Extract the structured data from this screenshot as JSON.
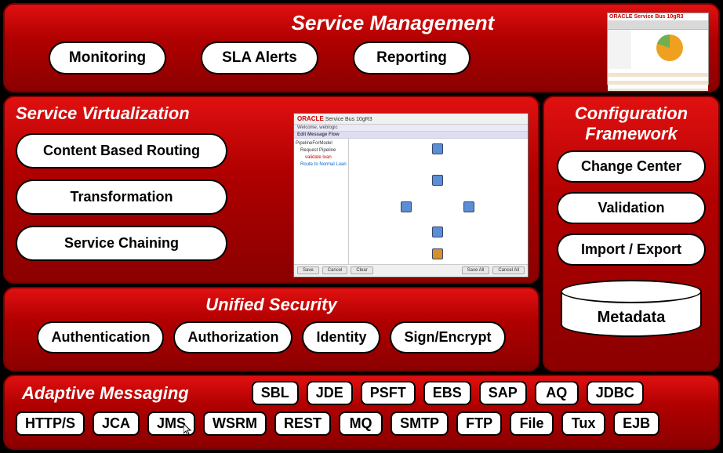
{
  "service_management": {
    "title": "Service Management",
    "items": [
      "Monitoring",
      "SLA Alerts",
      "Reporting"
    ],
    "thumb_label": "ORACLE Service Bus 10gR3"
  },
  "service_virtualization": {
    "title": "Service Virtualization",
    "items": [
      "Content Based Routing",
      "Transformation",
      "Service Chaining"
    ],
    "app": {
      "brand": "ORACLE",
      "product": "Service Bus 10gR3",
      "welcome": "Welcome, weblogic",
      "section": "Edit Message Flow",
      "tree": [
        "PipelineForModel",
        "Request Pipeline",
        "validate loan",
        "Route to Normal Loan Proce"
      ],
      "buttons": [
        "Save",
        "Cancel",
        "Clear",
        "Save All",
        "Cancel All"
      ]
    }
  },
  "unified_security": {
    "title": "Unified Security",
    "items": [
      "Authentication",
      "Authorization",
      "Identity",
      "Sign/Encrypt"
    ]
  },
  "configuration_framework": {
    "title_line1": "Configuration",
    "title_line2": "Framework",
    "items": [
      "Change Center",
      "Validation",
      "Import / Export"
    ],
    "store": "Metadata"
  },
  "adaptive_messaging": {
    "title": "Adaptive Messaging",
    "row1": [
      "SBL",
      "JDE",
      "PSFT",
      "EBS",
      "SAP",
      "AQ",
      "JDBC"
    ],
    "row2": [
      "HTTP/S",
      "JCA",
      "JMS",
      "WSRM",
      "REST",
      "MQ",
      "SMTP",
      "FTP",
      "File",
      "Tux",
      "EJB"
    ]
  }
}
